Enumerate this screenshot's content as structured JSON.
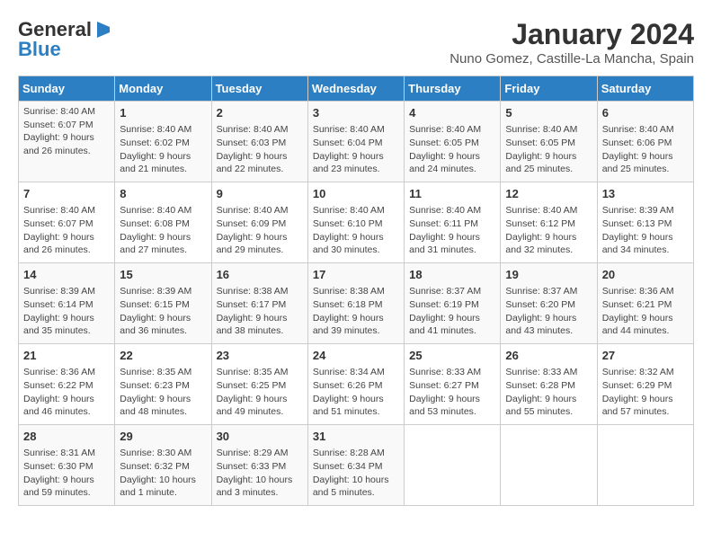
{
  "logo": {
    "line1": "General",
    "line2": "Blue"
  },
  "title": "January 2024",
  "subtitle": "Nuno Gomez, Castille-La Mancha, Spain",
  "days_of_week": [
    "Sunday",
    "Monday",
    "Tuesday",
    "Wednesday",
    "Thursday",
    "Friday",
    "Saturday"
  ],
  "weeks": [
    [
      {
        "num": "",
        "info": ""
      },
      {
        "num": "1",
        "info": "Sunrise: 8:40 AM\nSunset: 6:02 PM\nDaylight: 9 hours\nand 21 minutes."
      },
      {
        "num": "2",
        "info": "Sunrise: 8:40 AM\nSunset: 6:03 PM\nDaylight: 9 hours\nand 22 minutes."
      },
      {
        "num": "3",
        "info": "Sunrise: 8:40 AM\nSunset: 6:04 PM\nDaylight: 9 hours\nand 23 minutes."
      },
      {
        "num": "4",
        "info": "Sunrise: 8:40 AM\nSunset: 6:05 PM\nDaylight: 9 hours\nand 24 minutes."
      },
      {
        "num": "5",
        "info": "Sunrise: 8:40 AM\nSunset: 6:05 PM\nDaylight: 9 hours\nand 25 minutes."
      },
      {
        "num": "6",
        "info": "Sunrise: 8:40 AM\nSunset: 6:06 PM\nDaylight: 9 hours\nand 25 minutes."
      }
    ],
    [
      {
        "num": "7",
        "info": ""
      },
      {
        "num": "8",
        "info": "Sunrise: 8:40 AM\nSunset: 6:08 PM\nDaylight: 9 hours\nand 27 minutes."
      },
      {
        "num": "9",
        "info": "Sunrise: 8:40 AM\nSunset: 6:09 PM\nDaylight: 9 hours\nand 29 minutes."
      },
      {
        "num": "10",
        "info": "Sunrise: 8:40 AM\nSunset: 6:10 PM\nDaylight: 9 hours\nand 30 minutes."
      },
      {
        "num": "11",
        "info": "Sunrise: 8:40 AM\nSunset: 6:11 PM\nDaylight: 9 hours\nand 31 minutes."
      },
      {
        "num": "12",
        "info": "Sunrise: 8:40 AM\nSunset: 6:12 PM\nDaylight: 9 hours\nand 32 minutes."
      },
      {
        "num": "13",
        "info": "Sunrise: 8:39 AM\nSunset: 6:13 PM\nDaylight: 9 hours\nand 34 minutes."
      }
    ],
    [
      {
        "num": "14",
        "info": ""
      },
      {
        "num": "15",
        "info": "Sunrise: 8:39 AM\nSunset: 6:15 PM\nDaylight: 9 hours\nand 36 minutes."
      },
      {
        "num": "16",
        "info": "Sunrise: 8:38 AM\nSunset: 6:17 PM\nDaylight: 9 hours\nand 38 minutes."
      },
      {
        "num": "17",
        "info": "Sunrise: 8:38 AM\nSunset: 6:18 PM\nDaylight: 9 hours\nand 39 minutes."
      },
      {
        "num": "18",
        "info": "Sunrise: 8:37 AM\nSunset: 6:19 PM\nDaylight: 9 hours\nand 41 minutes."
      },
      {
        "num": "19",
        "info": "Sunrise: 8:37 AM\nSunset: 6:20 PM\nDaylight: 9 hours\nand 43 minutes."
      },
      {
        "num": "20",
        "info": "Sunrise: 8:36 AM\nSunset: 6:21 PM\nDaylight: 9 hours\nand 44 minutes."
      }
    ],
    [
      {
        "num": "21",
        "info": ""
      },
      {
        "num": "22",
        "info": "Sunrise: 8:35 AM\nSunset: 6:23 PM\nDaylight: 9 hours\nand 48 minutes."
      },
      {
        "num": "23",
        "info": "Sunrise: 8:35 AM\nSunset: 6:25 PM\nDaylight: 9 hours\nand 49 minutes."
      },
      {
        "num": "24",
        "info": "Sunrise: 8:34 AM\nSunset: 6:26 PM\nDaylight: 9 hours\nand 51 minutes."
      },
      {
        "num": "25",
        "info": "Sunrise: 8:33 AM\nSunset: 6:27 PM\nDaylight: 9 hours\nand 53 minutes."
      },
      {
        "num": "26",
        "info": "Sunrise: 8:33 AM\nSunset: 6:28 PM\nDaylight: 9 hours\nand 55 minutes."
      },
      {
        "num": "27",
        "info": "Sunrise: 8:32 AM\nSunset: 6:29 PM\nDaylight: 9 hours\nand 57 minutes."
      }
    ],
    [
      {
        "num": "28",
        "info": "Sunrise: 8:31 AM\nSunset: 6:30 PM\nDaylight: 9 hours\nand 59 minutes."
      },
      {
        "num": "29",
        "info": "Sunrise: 8:30 AM\nSunset: 6:32 PM\nDaylight: 10 hours\nand 1 minute."
      },
      {
        "num": "30",
        "info": "Sunrise: 8:29 AM\nSunset: 6:33 PM\nDaylight: 10 hours\nand 3 minutes."
      },
      {
        "num": "31",
        "info": "Sunrise: 8:28 AM\nSunset: 6:34 PM\nDaylight: 10 hours\nand 5 minutes."
      },
      {
        "num": "",
        "info": ""
      },
      {
        "num": "",
        "info": ""
      },
      {
        "num": "",
        "info": ""
      }
    ]
  ],
  "week1_sunday_info": "Sunrise: 8:40 AM\nSunset: 6:07 PM\nDaylight: 9 hours\nand 26 minutes.",
  "week2_sunday_info": "Sunrise: 8:40 AM\nSunset: 6:07 PM\nDaylight: 9 hours\nand 26 minutes.",
  "week3_sunday_info": "Sunrise: 8:39 AM\nSunset: 6:14 PM\nDaylight: 9 hours\nand 35 minutes.",
  "week4_sunday_info": "Sunrise: 8:36 AM\nSunset: 6:22 PM\nDaylight: 9 hours\nand 46 minutes."
}
